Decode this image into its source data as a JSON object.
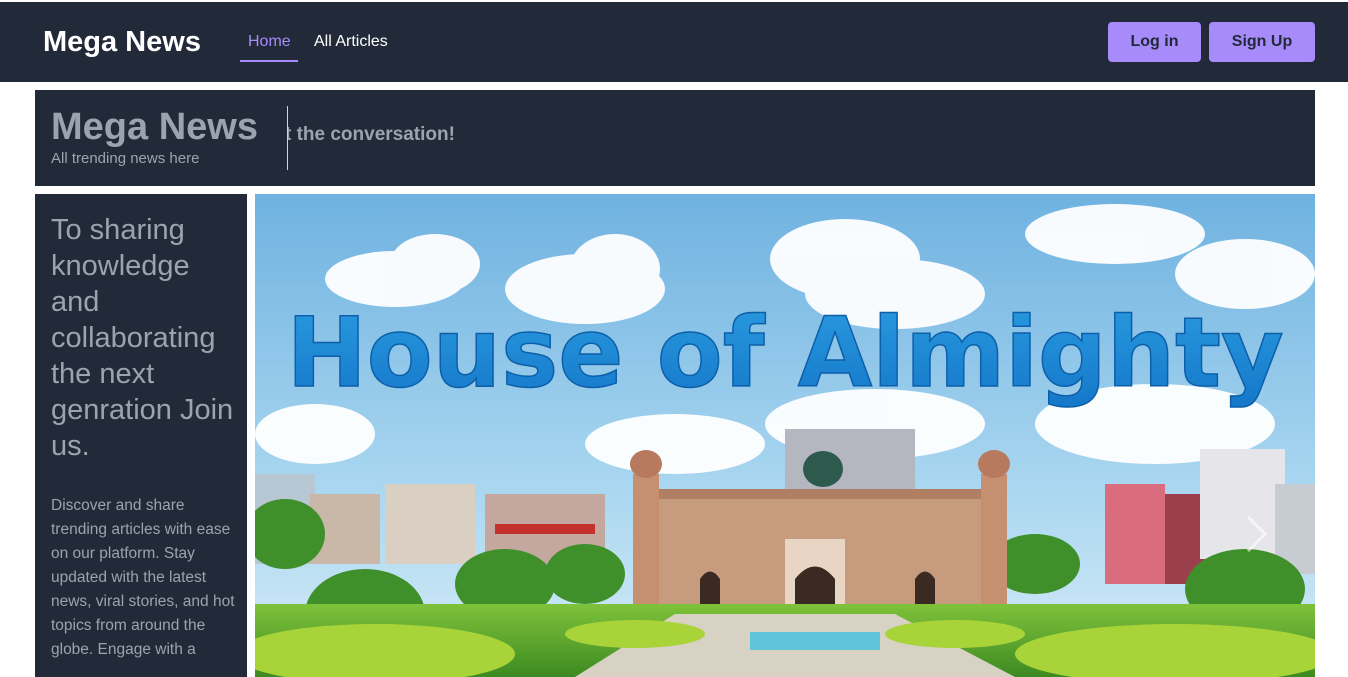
{
  "nav": {
    "brand": "Mega News",
    "links": [
      {
        "label": "Home",
        "active": true
      },
      {
        "label": "All Articles",
        "active": false
      }
    ],
    "login_label": "Log in",
    "signup_label": "Sign Up"
  },
  "hero": {
    "title": "Mega News",
    "subtitle": "All trending news here",
    "ticker": "Start the conversation!"
  },
  "sidebar": {
    "heading": "To sharing knowledge and collaborating the next genration Join us.",
    "body": "Discover and share trending articles with ease on our platform. Stay updated with the latest news, viral stories, and hot topics from around the globe. Engage with a"
  },
  "carousel": {
    "slide_text": "House of Almighty",
    "next_icon": "chevron-right-icon"
  },
  "colors": {
    "nav_bg": "#222a3a",
    "accent": "#a78bfa",
    "muted_text": "#9ca3af"
  }
}
